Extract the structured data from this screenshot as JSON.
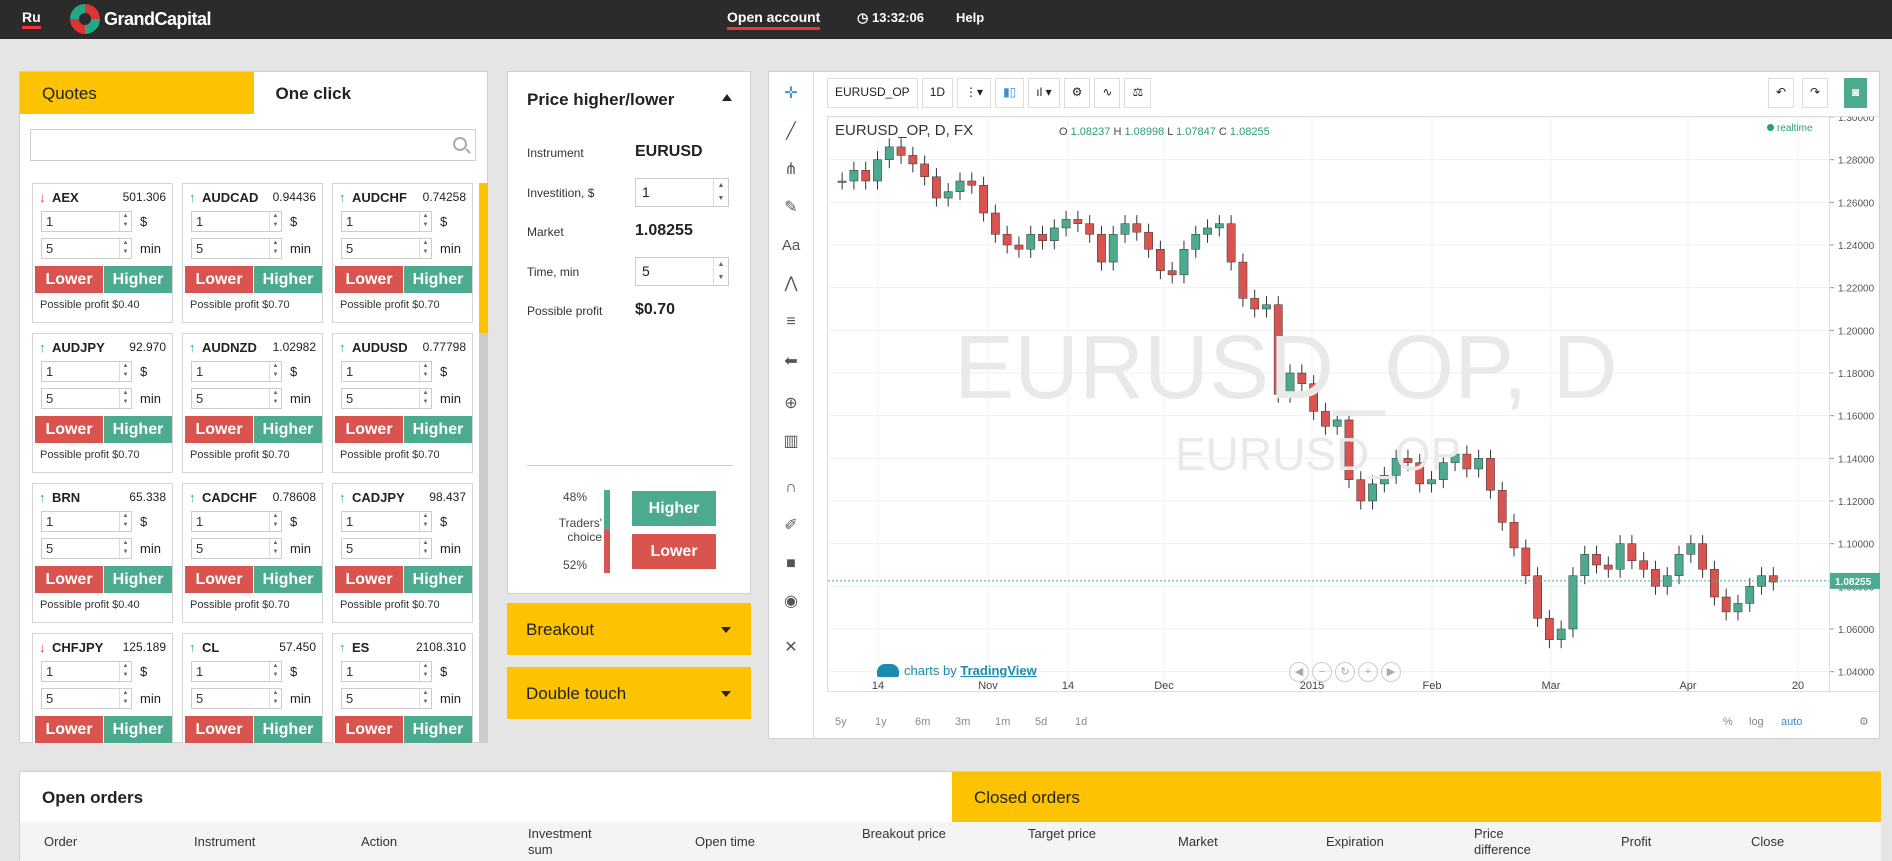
{
  "topbar": {
    "lang": "Ru",
    "brand": "GrandCapital",
    "open_account": "Open account",
    "time": "13:32:06",
    "help": "Help"
  },
  "quotes_panel": {
    "tab_quotes": "Quotes",
    "tab_one_click": "One click",
    "search_placeholder": "",
    "lower_label": "Lower",
    "higher_label": "Higher",
    "min_label": "min",
    "usd_label": "$",
    "cards": [
      {
        "symbol": "AEX",
        "dir": "down",
        "price": "501.306",
        "amount": "1",
        "time": "5",
        "profit": "Possible profit $0.40"
      },
      {
        "symbol": "AUDCAD",
        "dir": "up",
        "price": "0.94436",
        "amount": "1",
        "time": "5",
        "profit": "Possible profit $0.70"
      },
      {
        "symbol": "AUDCHF",
        "dir": "up",
        "price": "0.74258",
        "amount": "1",
        "time": "5",
        "profit": "Possible profit $0.70"
      },
      {
        "symbol": "AUDJPY",
        "dir": "up",
        "price": "92.970",
        "amount": "1",
        "time": "5",
        "profit": "Possible profit $0.70"
      },
      {
        "symbol": "AUDNZD",
        "dir": "up",
        "price": "1.02982",
        "amount": "1",
        "time": "5",
        "profit": "Possible profit $0.70"
      },
      {
        "symbol": "AUDUSD",
        "dir": "up",
        "price": "0.77798",
        "amount": "1",
        "time": "5",
        "profit": "Possible profit $0.70"
      },
      {
        "symbol": "BRN",
        "dir": "up",
        "price": "65.338",
        "amount": "1",
        "time": "5",
        "profit": "Possible profit $0.40"
      },
      {
        "symbol": "CADCHF",
        "dir": "up",
        "price": "0.78608",
        "amount": "1",
        "time": "5",
        "profit": "Possible profit $0.70"
      },
      {
        "symbol": "CADJPY",
        "dir": "up",
        "price": "98.437",
        "amount": "1",
        "time": "5",
        "profit": "Possible profit $0.70"
      },
      {
        "symbol": "CHFJPY",
        "dir": "down",
        "price": "125.189",
        "amount": "1",
        "time": "5",
        "profit": ""
      },
      {
        "symbol": "CL",
        "dir": "up",
        "price": "57.450",
        "amount": "1",
        "time": "5",
        "profit": ""
      },
      {
        "symbol": "ES",
        "dir": "up",
        "price": "2108.310",
        "amount": "1",
        "time": "5",
        "profit": ""
      }
    ]
  },
  "trade_panel": {
    "title": "Price higher/lower",
    "instrument_label": "Instrument",
    "instrument_value": "EURUSD",
    "investition_label": "Investition, $",
    "investition_value": "1",
    "market_label": "Market",
    "market_value": "1.08255",
    "time_label": "Time, min",
    "time_value": "5",
    "profit_label": "Possible profit",
    "profit_value": "$0.70",
    "higher_pct": "48%",
    "lower_pct": "52%",
    "higher_fraction": 0.48,
    "traders_choice": "Traders' choice",
    "higher_btn": "Higher",
    "lower_btn": "Lower",
    "breakout": "Breakout",
    "double_touch": "Double touch"
  },
  "chart_toolbar": {
    "symbol": "EURUSD_OP",
    "interval": "1D"
  },
  "chart_data": {
    "type": "candlestick",
    "legend": "EURUSD_OP, D, FX",
    "ohlc": {
      "o_label": "O",
      "o": "1.08237",
      "h_label": "H",
      "h": "1.08998",
      "l_label": "L",
      "l": "1.07847",
      "c_label": "C",
      "c": "1.08255"
    },
    "realtime": "realtime",
    "watermark_main": "EURUSD_OP, D",
    "watermark_sub": "EURUSD_OP",
    "last_price": "1.08255",
    "last_value": 1.08255,
    "ylim": [
      1.03,
      1.3
    ],
    "y_ticks": [
      "1.30000",
      "1.28000",
      "1.26000",
      "1.24000",
      "1.22000",
      "1.20000",
      "1.18000",
      "1.16000",
      "1.14000",
      "1.12000",
      "1.10000",
      "1.08000",
      "1.06000",
      "1.04000"
    ],
    "x_ticks": [
      "14",
      "Nov",
      "14",
      "Dec",
      "2015",
      "Feb",
      "Mar",
      "Apr",
      "20"
    ],
    "close_path": [
      1.27,
      1.275,
      1.27,
      1.28,
      1.286,
      1.282,
      1.278,
      1.272,
      1.262,
      1.265,
      1.27,
      1.268,
      1.255,
      1.245,
      1.24,
      1.238,
      1.245,
      1.242,
      1.248,
      1.252,
      1.25,
      1.245,
      1.232,
      1.245,
      1.25,
      1.246,
      1.238,
      1.228,
      1.226,
      1.238,
      1.245,
      1.248,
      1.25,
      1.232,
      1.215,
      1.21,
      1.212,
      1.17,
      1.18,
      1.175,
      1.162,
      1.155,
      1.158,
      1.13,
      1.12,
      1.128,
      1.132,
      1.14,
      1.138,
      1.128,
      1.13,
      1.138,
      1.142,
      1.135,
      1.14,
      1.125,
      1.11,
      1.098,
      1.085,
      1.065,
      1.055,
      1.06,
      1.085,
      1.095,
      1.09,
      1.088,
      1.1,
      1.092,
      1.088,
      1.08,
      1.085,
      1.095,
      1.1,
      1.088,
      1.075,
      1.068,
      1.072,
      1.08,
      1.085,
      1.082
    ],
    "footer": {
      "ranges": [
        "5y",
        "1y",
        "6m",
        "3m",
        "1m",
        "5d",
        "1d"
      ],
      "pct": "%",
      "log": "log",
      "auto": "auto"
    },
    "attribution_prefix": "charts by",
    "attribution_brand": "TradingView",
    "colors": {
      "up": "#4caa8f",
      "down": "#d9534f"
    }
  },
  "orders": {
    "open_tab": "Open orders",
    "closed_tab": "Closed orders",
    "columns": [
      "Order",
      "Instrument",
      "Action",
      "Investment sum",
      "Open time",
      "Breakout price",
      "Target price",
      "Market",
      "Expiration",
      "Price difference",
      "Profit",
      "Close"
    ]
  }
}
